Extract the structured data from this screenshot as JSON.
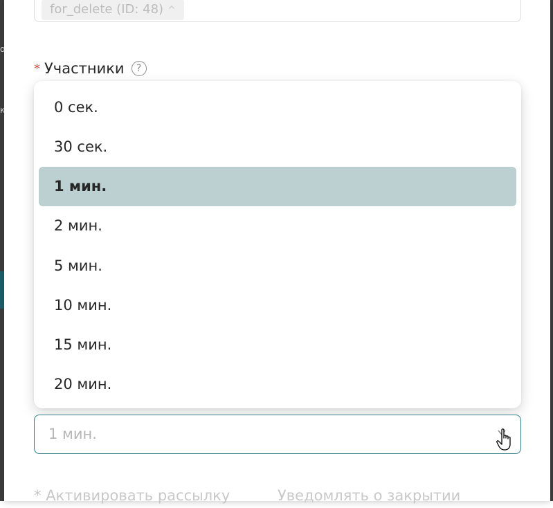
{
  "top_field": {
    "tag_label": "for_delete (ID: 48)"
  },
  "participants": {
    "required_mark": "*",
    "label": "Участники",
    "help_symbol": "?"
  },
  "dropdown": {
    "options": [
      "0 сек.",
      "30 сек.",
      "1 мин.",
      "2 мин.",
      "5 мин.",
      "10 мин.",
      "15 мин.",
      "20 мин."
    ],
    "selected": "1 мин."
  },
  "select": {
    "value": "1 мин."
  },
  "bottom": {
    "required_mark": "*",
    "left_label": "Активировать рассылку",
    "right_label": "Уведомлять о закрытии"
  },
  "colors": {
    "accent": "#2c7d86",
    "selected_bg": "#bcd0d1",
    "required": "#e0453c"
  }
}
